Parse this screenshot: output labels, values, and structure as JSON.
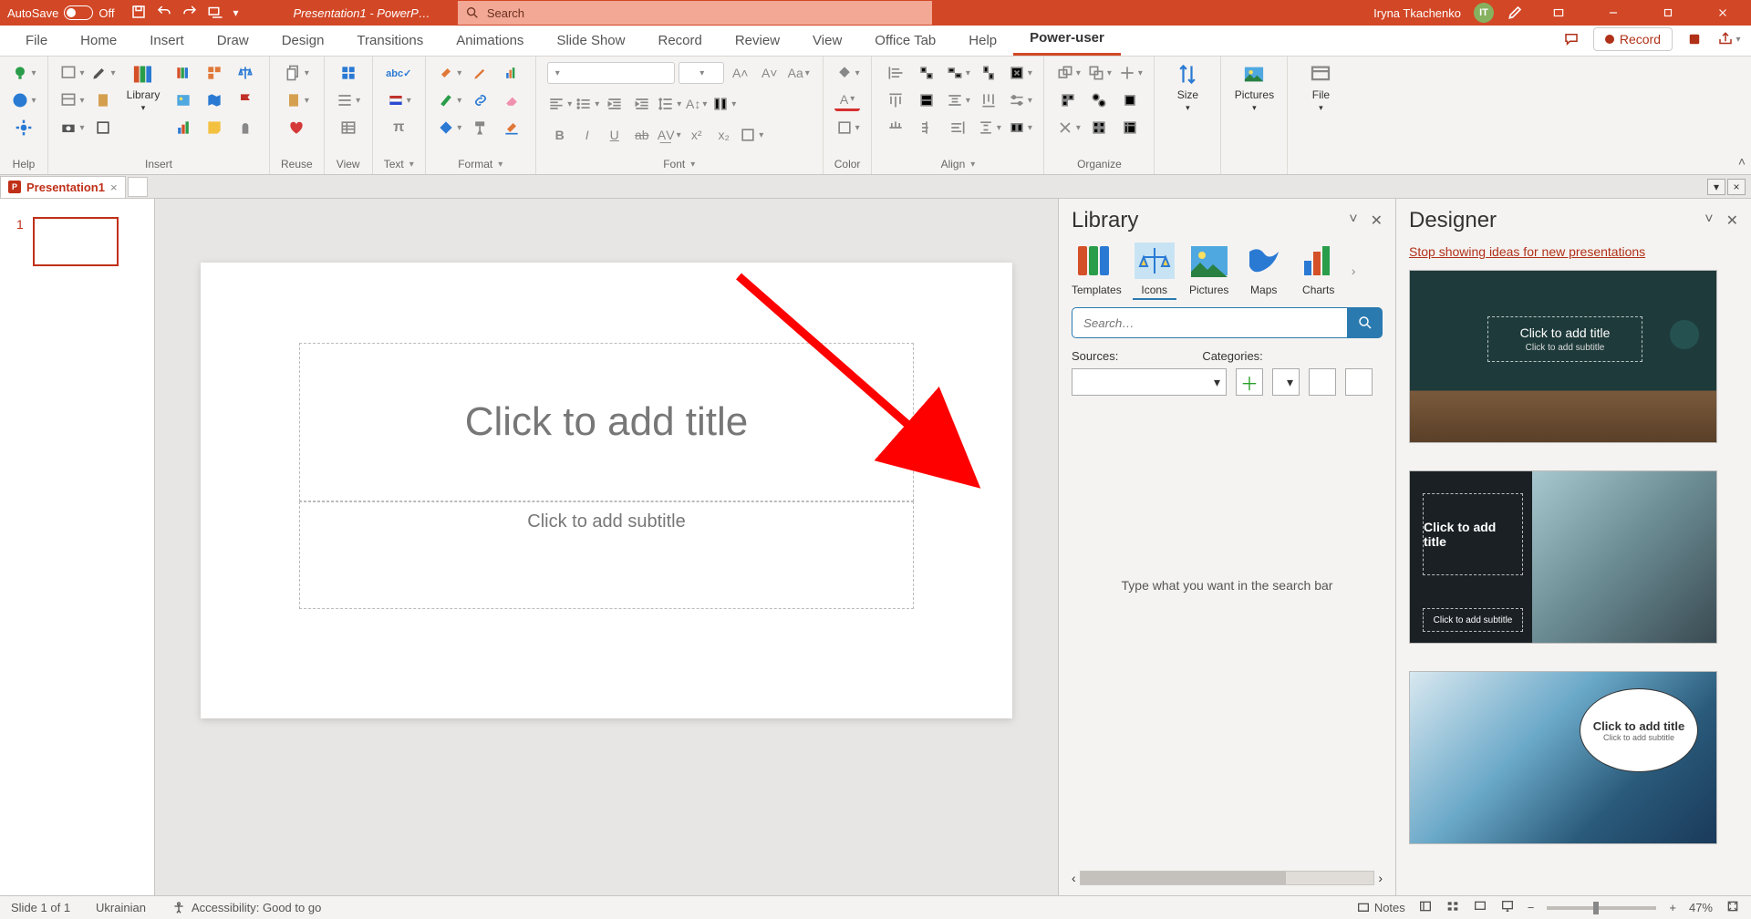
{
  "title_bar": {
    "autosave_label": "AutoSave",
    "autosave_state": "Off",
    "doc_title": "Presentation1 - PowerP…",
    "search_placeholder": "Search",
    "user_name": "Iryna Tkachenko",
    "user_initials": "IT"
  },
  "tabs": [
    "File",
    "Home",
    "Insert",
    "Draw",
    "Design",
    "Transitions",
    "Animations",
    "Slide Show",
    "Record",
    "Review",
    "View",
    "Office Tab",
    "Help",
    "Power-user"
  ],
  "active_tab": "Power-user",
  "ribbon_groups": [
    "Help",
    "Insert",
    "Reuse",
    "View",
    "Text",
    "Format",
    "Font",
    "Color",
    "Align",
    "Organize",
    "Size",
    "Pictures",
    "File"
  ],
  "ribbon": {
    "library_label": "Library",
    "record_label": "Record",
    "size_label": "Size",
    "pictures_label": "Pictures",
    "file_label": "File"
  },
  "doc_tab": {
    "name": "Presentation1"
  },
  "thumb": {
    "num": "1"
  },
  "slide": {
    "title_ph": "Click to add title",
    "sub_ph": "Click to add subtitle"
  },
  "library_pane": {
    "title": "Library",
    "tabs": [
      "Templates",
      "Icons",
      "Pictures",
      "Maps",
      "Charts"
    ],
    "active": "Icons",
    "search_ph": "Search…",
    "sources_label": "Sources:",
    "categories_label": "Categories:",
    "empty_msg": "Type what you want in the search bar"
  },
  "designer_pane": {
    "title": "Designer",
    "link": "Stop showing ideas for new presentations",
    "thumbs": [
      {
        "title": "Click to add title",
        "sub": "Click to add subtitle"
      },
      {
        "title": "Click to add title",
        "sub": "Click to add subtitle"
      },
      {
        "title": "Click to add title",
        "sub": "Click to add subtitle"
      }
    ]
  },
  "status": {
    "slide": "Slide 1 of 1",
    "lang": "Ukrainian",
    "a11y": "Accessibility: Good to go",
    "notes": "Notes",
    "zoom": "47%"
  }
}
